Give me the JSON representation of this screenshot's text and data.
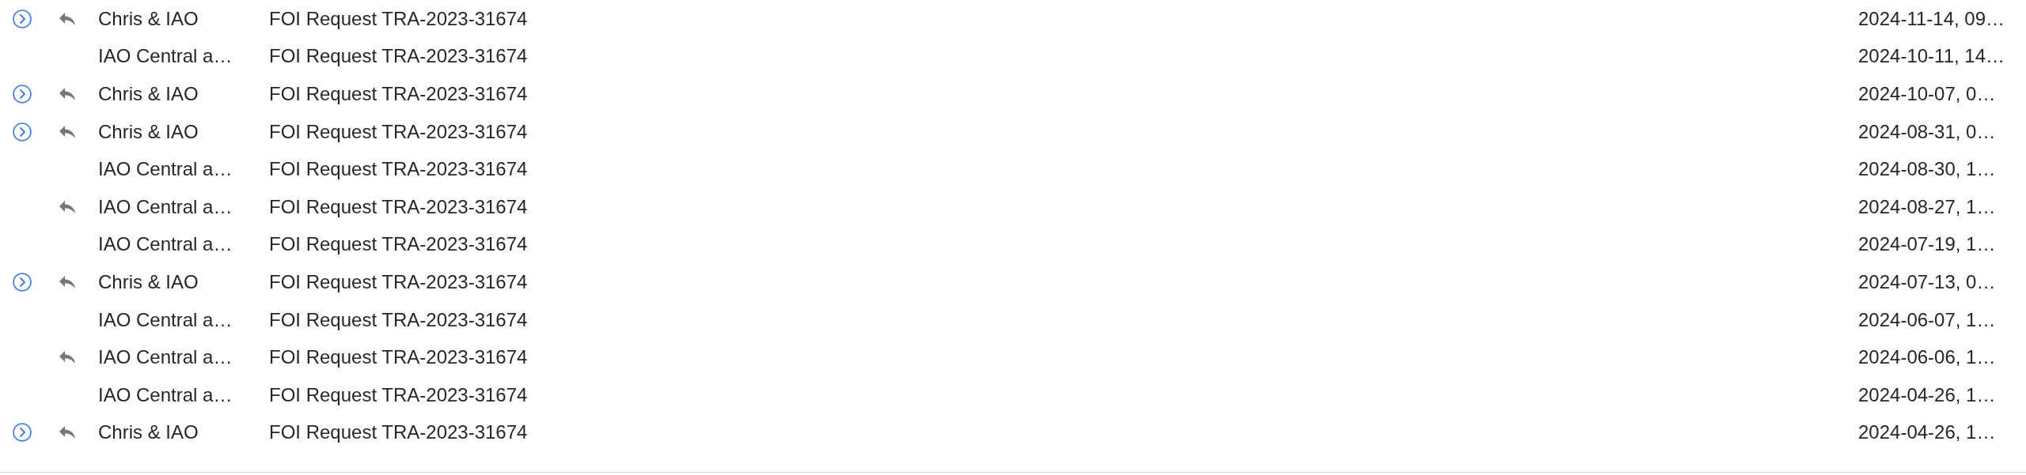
{
  "messages": [
    {
      "thread": true,
      "replied": true,
      "sender": "Chris & IAO",
      "subject": "FOI Request TRA-2023-31674",
      "date": "2024-11-14, 09…"
    },
    {
      "thread": false,
      "replied": false,
      "sender": "IAO Central a…",
      "subject": "FOI Request TRA-2023-31674",
      "date": "2024-10-11, 14…"
    },
    {
      "thread": true,
      "replied": true,
      "sender": "Chris & IAO",
      "subject": "FOI Request TRA-2023-31674",
      "date": "2024-10-07, 0…"
    },
    {
      "thread": true,
      "replied": true,
      "sender": "Chris & IAO",
      "subject": "FOI Request TRA-2023-31674",
      "date": "2024-08-31, 0…"
    },
    {
      "thread": false,
      "replied": false,
      "sender": "IAO Central a…",
      "subject": "FOI Request TRA-2023-31674",
      "date": "2024-08-30, 1…"
    },
    {
      "thread": false,
      "replied": true,
      "sender": "IAO Central a…",
      "subject": "FOI Request TRA-2023-31674",
      "date": "2024-08-27, 1…"
    },
    {
      "thread": false,
      "replied": false,
      "sender": "IAO Central a…",
      "subject": "FOI Request TRA-2023-31674",
      "date": "2024-07-19, 1…"
    },
    {
      "thread": true,
      "replied": true,
      "sender": "Chris & IAO",
      "subject": "FOI Request TRA-2023-31674",
      "date": "2024-07-13, 0…"
    },
    {
      "thread": false,
      "replied": false,
      "sender": "IAO Central a…",
      "subject": "FOI Request TRA-2023-31674",
      "date": "2024-06-07, 1…"
    },
    {
      "thread": false,
      "replied": true,
      "sender": "IAO Central a…",
      "subject": "FOI Request TRA-2023-31674",
      "date": "2024-06-06, 1…"
    },
    {
      "thread": false,
      "replied": false,
      "sender": "IAO Central a…",
      "subject": "FOI Request TRA-2023-31674",
      "date": "2024-04-26, 1…"
    },
    {
      "thread": true,
      "replied": true,
      "sender": "Chris & IAO",
      "subject": "FOI Request TRA-2023-31674",
      "date": "2024-04-26, 1…"
    }
  ]
}
